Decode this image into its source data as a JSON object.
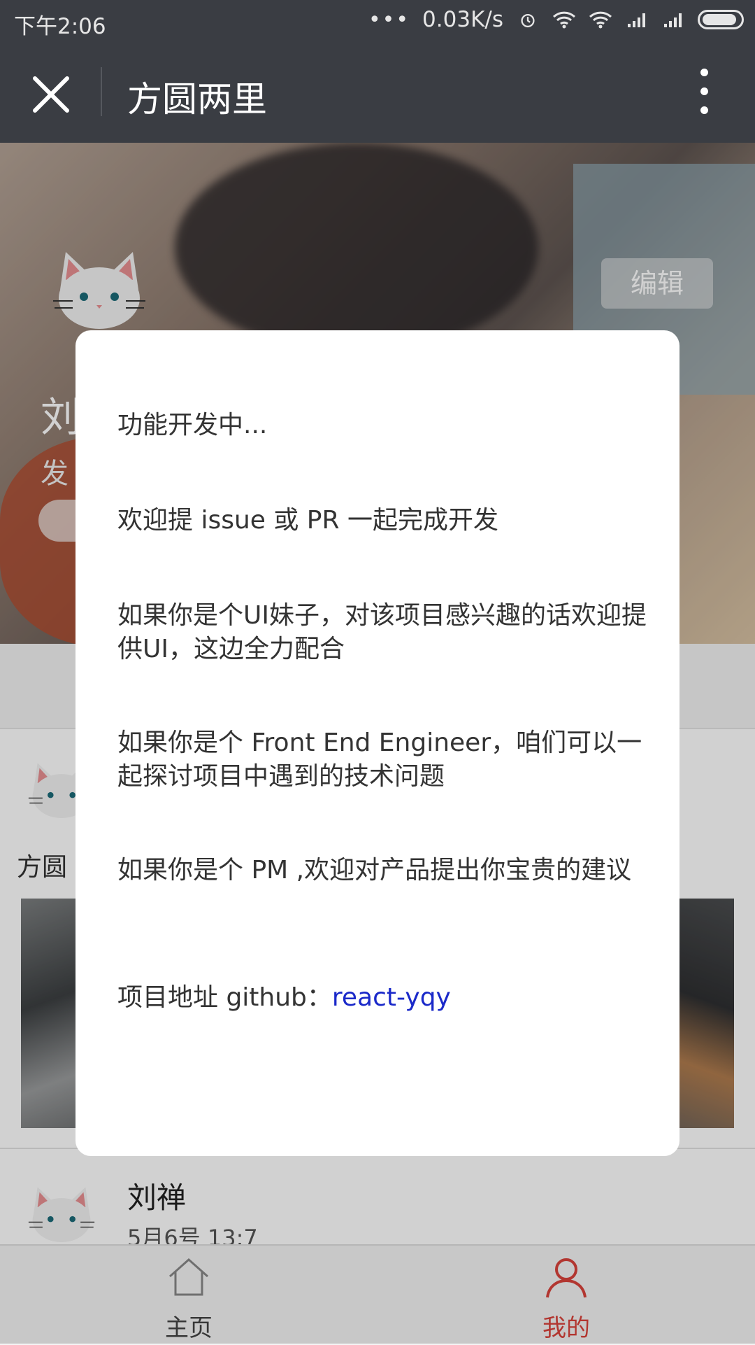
{
  "status_bar": {
    "time": "下午2:06",
    "dots": "•••",
    "speed": "0.03K/s",
    "icons": [
      "alarm-icon",
      "wifi-icon",
      "wifi-icon",
      "signal-icon",
      "signal-icon",
      "battery-icon"
    ]
  },
  "nav": {
    "title": "方圆两里",
    "close_icon": "close-icon",
    "more_icon": "more-vertical-icon"
  },
  "profile": {
    "edit_label": "编辑",
    "name_partial": "刘",
    "subtitle_partial": "发"
  },
  "feed": {
    "first_post_caption": "方圆",
    "second_post": {
      "author": "刘禅",
      "time": "5月6号 13:7"
    }
  },
  "modal": {
    "line1": "功能开发中...",
    "line2": "欢迎提 issue 或 PR 一起完成开发",
    "line3": "如果你是个UI妹子，对该项目感兴趣的话欢迎提供UI，这边全力配合",
    "line4": "如果你是个 Front End Engineer，咱们可以一起探讨项目中遇到的技术问题",
    "line5": "如果你是个 PM ,欢迎对产品提出你宝贵的建议",
    "line6_prefix": "项目地址 github：",
    "line6_link": "react-yqy"
  },
  "tabs": {
    "home_label": "主页",
    "mine_label": "我的",
    "active": "mine"
  },
  "colors": {
    "nav_bg": "#3a3d43",
    "accent": "#d9433b",
    "link": "#1a29c9"
  }
}
